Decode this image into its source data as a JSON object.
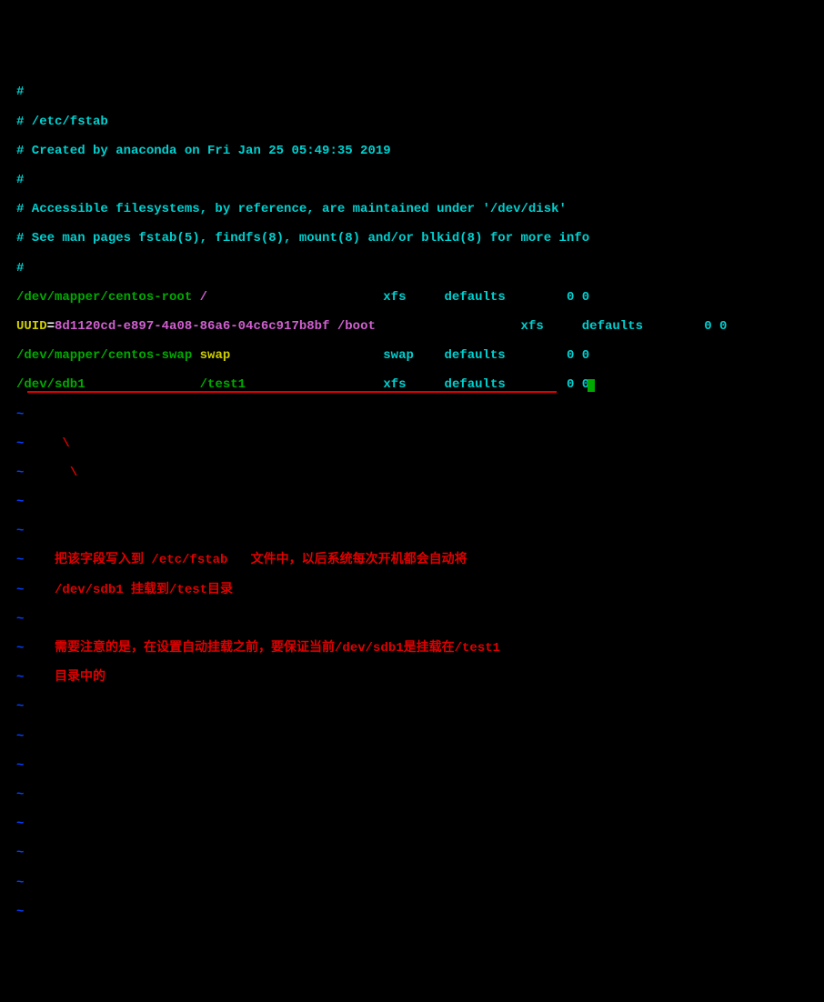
{
  "comments": {
    "l1": "#",
    "l2": "# /etc/fstab",
    "l3": "# Created by anaconda on Fri Jan 25 05:49:35 2019",
    "l4": "#",
    "l5": "# Accessible filesystems, by reference, are maintained under '/dev/disk'",
    "l6": "# See man pages fstab(5), findfs(8), mount(8) and/or blkid(8) for more info",
    "l7": "#"
  },
  "fstab": {
    "row1": {
      "device": "/dev/mapper/centos-root",
      "mount": " /",
      "fs": "xfs",
      "opts": "defaults",
      "dump": "0 0"
    },
    "row2": {
      "prefix": "UUID",
      "eq": "=",
      "uuid": "8d1120cd-e897-4a08-86a6-04c6c917b8bf",
      "mount": " /boot",
      "fs": "xfs",
      "opts": "defaults",
      "dump": "0 0"
    },
    "row3": {
      "device": "/dev/mapper/centos-swap",
      "mount": " swap",
      "fs": "swap",
      "opts": "defaults",
      "dump": "0 0"
    },
    "row4": {
      "device": "/dev/sdb1",
      "mount": "/test1",
      "fs": "xfs",
      "opts": "defaults",
      "dump": "0 0"
    }
  },
  "tilde": "~",
  "annotations": {
    "line1": "把该字段写入到 /etc/fstab   文件中，以后系统每次开机都会自动将",
    "line2": "/dev/sdb1 挂载到/test目录",
    "line3": "需要注意的是，在设置自动挂载之前，要保证当前/dev/sdb1是挂载在/test1",
    "line4": "目录中的"
  }
}
